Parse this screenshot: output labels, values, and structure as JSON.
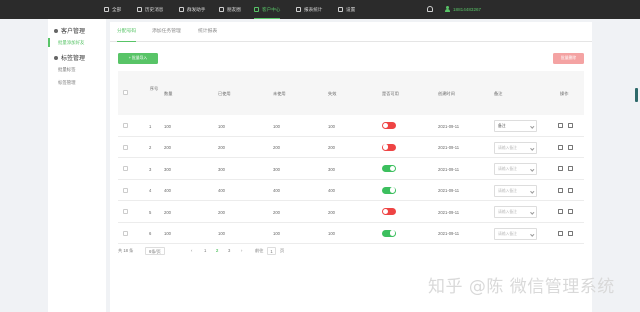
{
  "topnav": {
    "items": [
      {
        "label": "全部",
        "icon": "home-icon"
      },
      {
        "label": "历史消息",
        "icon": "message-icon"
      },
      {
        "label": "群发助手",
        "icon": "send-icon"
      },
      {
        "label": "朋友圈",
        "icon": "moments-icon"
      },
      {
        "label": "客户中心",
        "icon": "user-icon",
        "active": true
      },
      {
        "label": "报表统计",
        "icon": "chart-icon"
      },
      {
        "label": "设置",
        "icon": "gear-icon"
      }
    ],
    "phone": "18814483267"
  },
  "sidebar": {
    "groups": [
      {
        "label": "客户管理",
        "items": [
          "批量添加好友"
        ]
      },
      {
        "label": "标签管理",
        "items": [
          "批量标签",
          "标签管理"
        ]
      }
    ]
  },
  "tabs": [
    "分配号码",
    "添加任务管理",
    "统计报表"
  ],
  "toolbar": {
    "add_label": "+ 批量导入",
    "batch_label": "批量删除"
  },
  "table": {
    "headers": [
      "序号",
      "数量",
      "已使用",
      "未使用",
      "失效",
      "是否可用",
      "创建时间",
      "备注",
      "操作"
    ],
    "rows": [
      {
        "index": "1",
        "total": "100",
        "used": "100",
        "unused": "100",
        "invalid": "100",
        "enabled": false,
        "created": "2021-09-11",
        "note": "备注",
        "note_filled": true
      },
      {
        "index": "2",
        "total": "200",
        "used": "200",
        "unused": "200",
        "invalid": "200",
        "enabled": false,
        "created": "2021-09-11",
        "note": "请输入备注",
        "note_filled": false
      },
      {
        "index": "3",
        "total": "300",
        "used": "300",
        "unused": "300",
        "invalid": "300",
        "enabled": true,
        "created": "2021-09-11",
        "note": "请输入备注",
        "note_filled": false
      },
      {
        "index": "4",
        "total": "400",
        "used": "400",
        "unused": "400",
        "invalid": "400",
        "enabled": true,
        "created": "2021-09-11",
        "note": "请输入备注",
        "note_filled": false
      },
      {
        "index": "5",
        "total": "200",
        "used": "200",
        "unused": "200",
        "invalid": "200",
        "enabled": false,
        "created": "2021-09-11",
        "note": "请输入备注",
        "note_filled": false
      },
      {
        "index": "6",
        "total": "100",
        "used": "100",
        "unused": "100",
        "invalid": "100",
        "enabled": true,
        "created": "2021-09-11",
        "note": "请输入备注",
        "note_filled": false
      }
    ]
  },
  "pagination": {
    "total": "共 18 条",
    "page_size": "6条/页",
    "prev": "‹",
    "pages": [
      "1",
      "2",
      "3"
    ],
    "current": "2",
    "next": "›",
    "goto_label": "前往",
    "goto_value": "1",
    "goto_suffix": "页"
  },
  "watermark": "知乎 @陈 微信管理系统"
}
